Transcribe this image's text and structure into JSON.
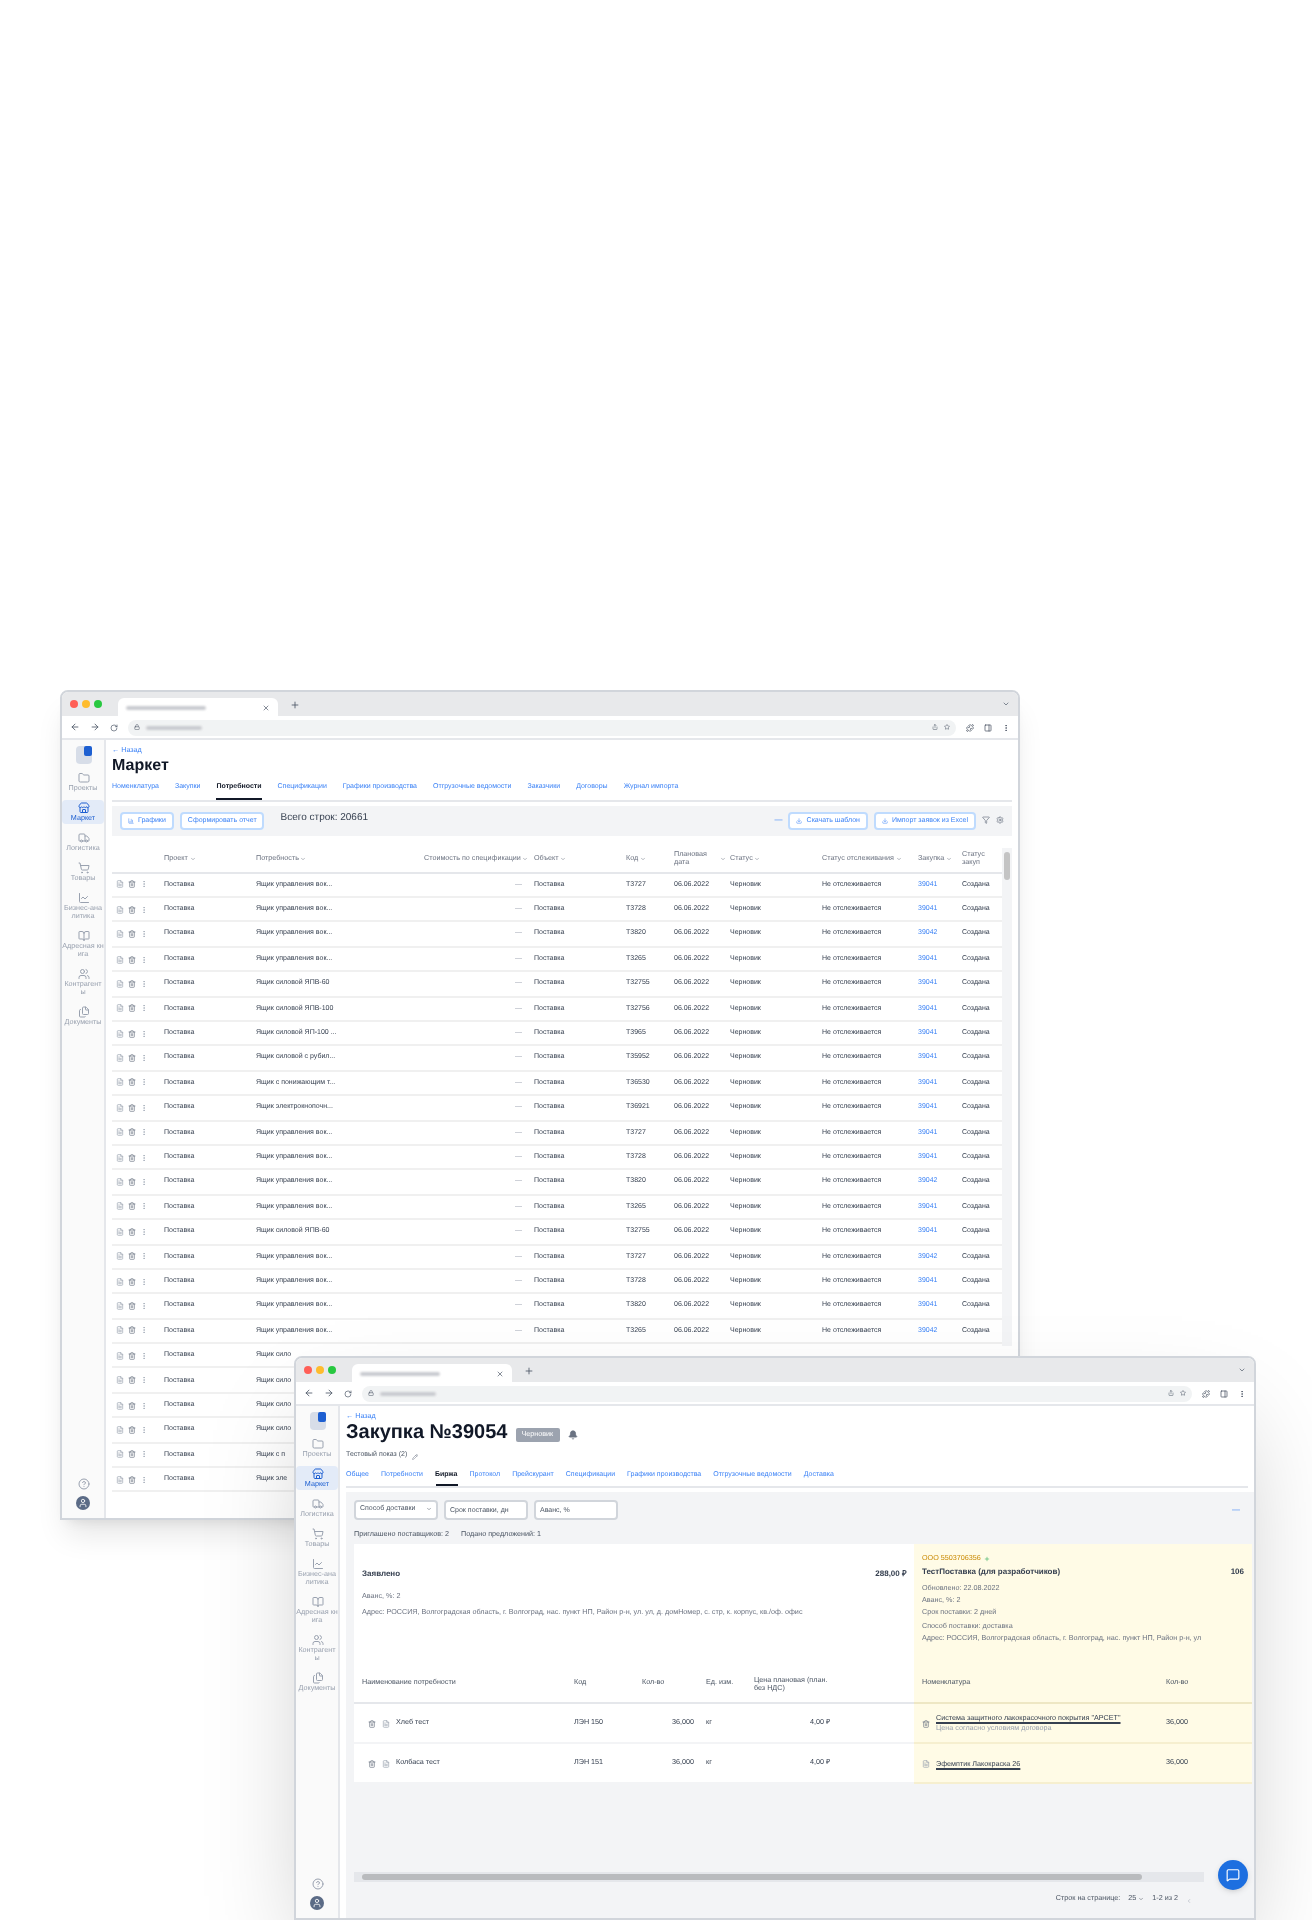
{
  "back_window": {
    "sidebar": {
      "items": [
        {
          "kind": "projects",
          "label": "Проекты",
          "selected": false
        },
        {
          "kind": "market",
          "label": "Маркет",
          "selected": true
        },
        {
          "kind": "logistics",
          "label": "Логистика",
          "selected": false
        },
        {
          "kind": "goods",
          "label": "Товары",
          "selected": false
        },
        {
          "kind": "analytics",
          "label": "Бизнес-аналитика",
          "selected": false
        },
        {
          "kind": "addressbook",
          "label": "Адресная книга",
          "selected": false
        },
        {
          "kind": "contractors",
          "label": "Контрагенты",
          "selected": false
        },
        {
          "kind": "documents",
          "label": "Документы",
          "selected": false
        }
      ]
    },
    "breadcrumb": "← Назад",
    "title": "Маркет",
    "tabs": [
      {
        "label": "Номенклатура",
        "selected": false
      },
      {
        "label": "Закупки",
        "selected": false
      },
      {
        "label": "Потребности",
        "selected": true
      },
      {
        "label": "Спецификации",
        "selected": false
      },
      {
        "label": "Графики производства",
        "selected": false
      },
      {
        "label": "Отгрузочные ведомости",
        "selected": false
      },
      {
        "label": "Заказчики",
        "selected": false
      },
      {
        "label": "Договоры",
        "selected": false
      },
      {
        "label": "Журнал импорта",
        "selected": false
      }
    ],
    "toolbar": {
      "charts_button": "Графики",
      "report_button": "Сформировать отчет",
      "total": "Всего строк: 20661",
      "dash": "—",
      "template_button": "Скачать шаблон",
      "import_button": "Импорт заявок из Excel"
    },
    "table": {
      "columns": [
        "Проект",
        "Потребность",
        "Стоимость по спецификации",
        "Объект",
        "Код",
        "Плановая дата",
        "Статус",
        "Статус отслеживания",
        "Закупка",
        "Статус закуп"
      ],
      "rows": [
        {
          "project": "Поставка",
          "need": "Ящик управления вок...",
          "spec": "—",
          "object": "Поставка",
          "code": "Т3727",
          "date": "06.06.2022",
          "status": "Черновик",
          "tracking": "Не отслеживается",
          "purchase": "39041",
          "purchase_status": "Создана"
        },
        {
          "project": "Поставка",
          "need": "Ящик управления вок...",
          "spec": "—",
          "object": "Поставка",
          "code": "Т3728",
          "date": "06.06.2022",
          "status": "Черновик",
          "tracking": "Не отслеживается",
          "purchase": "39041",
          "purchase_status": "Создана"
        },
        {
          "project": "Поставка",
          "need": "Ящик управления вок...",
          "spec": "—",
          "object": "Поставка",
          "code": "Т3820",
          "date": "06.06.2022",
          "status": "Черновик",
          "tracking": "Не отслеживается",
          "purchase": "39042",
          "purchase_status": "Создана"
        },
        {
          "project": "Поставка",
          "need": "Ящик управления вок...",
          "spec": "—",
          "object": "Поставка",
          "code": "Т3265",
          "date": "06.06.2022",
          "status": "Черновик",
          "tracking": "Не отслеживается",
          "purchase": "39041",
          "purchase_status": "Создана"
        },
        {
          "project": "Поставка",
          "need": "Ящик силовой ЯПВ-60",
          "spec": "—",
          "object": "Поставка",
          "code": "Т32755",
          "date": "06.06.2022",
          "status": "Черновик",
          "tracking": "Не отслеживается",
          "purchase": "39041",
          "purchase_status": "Создана"
        },
        {
          "project": "Поставка",
          "need": "Ящик силовой ЯПВ-100",
          "spec": "—",
          "object": "Поставка",
          "code": "Т32756",
          "date": "06.06.2022",
          "status": "Черновик",
          "tracking": "Не отслеживается",
          "purchase": "39041",
          "purchase_status": "Создана"
        },
        {
          "project": "Поставка",
          "need": "Ящик силовой ЯП-100 ...",
          "spec": "—",
          "object": "Поставка",
          "code": "Т3965",
          "date": "06.06.2022",
          "status": "Черновик",
          "tracking": "Не отслеживается",
          "purchase": "39041",
          "purchase_status": "Создана"
        },
        {
          "project": "Поставка",
          "need": "Ящик силовой с рубил...",
          "spec": "—",
          "object": "Поставка",
          "code": "Т35952",
          "date": "06.06.2022",
          "status": "Черновик",
          "tracking": "Не отслеживается",
          "purchase": "39041",
          "purchase_status": "Создана"
        },
        {
          "project": "Поставка",
          "need": "Ящик с понижающим т...",
          "spec": "—",
          "object": "Поставка",
          "code": "Т36530",
          "date": "06.06.2022",
          "status": "Черновик",
          "tracking": "Не отслеживается",
          "purchase": "39041",
          "purchase_status": "Создана"
        },
        {
          "project": "Поставка",
          "need": "Ящик электрокнопочн...",
          "spec": "—",
          "object": "Поставка",
          "code": "Т36921",
          "date": "06.06.2022",
          "status": "Черновик",
          "tracking": "Не отслеживается",
          "purchase": "39041",
          "purchase_status": "Создана"
        },
        {
          "project": "Поставка",
          "need": "Ящик управления вок...",
          "spec": "—",
          "object": "Поставка",
          "code": "Т3727",
          "date": "06.06.2022",
          "status": "Черновик",
          "tracking": "Не отслеживается",
          "purchase": "39041",
          "purchase_status": "Создана"
        },
        {
          "project": "Поставка",
          "need": "Ящик управления вок...",
          "spec": "—",
          "object": "Поставка",
          "code": "Т3728",
          "date": "06.06.2022",
          "status": "Черновик",
          "tracking": "Не отслеживается",
          "purchase": "39041",
          "purchase_status": "Создана"
        },
        {
          "project": "Поставка",
          "need": "Ящик управления вок...",
          "spec": "—",
          "object": "Поставка",
          "code": "Т3820",
          "date": "06.06.2022",
          "status": "Черновик",
          "tracking": "Не отслеживается",
          "purchase": "39042",
          "purchase_status": "Создана"
        },
        {
          "project": "Поставка",
          "need": "Ящик управления вок...",
          "spec": "—",
          "object": "Поставка",
          "code": "Т3265",
          "date": "06.06.2022",
          "status": "Черновик",
          "tracking": "Не отслеживается",
          "purchase": "39041",
          "purchase_status": "Создана"
        },
        {
          "project": "Поставка",
          "need": "Ящик силовой ЯПВ-60",
          "spec": "—",
          "object": "Поставка",
          "code": "Т32755",
          "date": "06.06.2022",
          "status": "Черновик",
          "tracking": "Не отслеживается",
          "purchase": "39041",
          "purchase_status": "Создана"
        },
        {
          "project": "Поставка",
          "need": "Ящик управления вок...",
          "spec": "—",
          "object": "Поставка",
          "code": "Т3727",
          "date": "06.06.2022",
          "status": "Черновик",
          "tracking": "Не отслеживается",
          "purchase": "39042",
          "purchase_status": "Создана"
        },
        {
          "project": "Поставка",
          "need": "Ящик управления вок...",
          "spec": "—",
          "object": "Поставка",
          "code": "Т3728",
          "date": "06.06.2022",
          "status": "Черновик",
          "tracking": "Не отслеживается",
          "purchase": "39041",
          "purchase_status": "Создана"
        },
        {
          "project": "Поставка",
          "need": "Ящик управления вок...",
          "spec": "—",
          "object": "Поставка",
          "code": "Т3820",
          "date": "06.06.2022",
          "status": "Черновик",
          "tracking": "Не отслеживается",
          "purchase": "39041",
          "purchase_status": "Создана"
        },
        {
          "project": "Поставка",
          "need": "Ящик управления вок...",
          "spec": "—",
          "object": "Поставка",
          "code": "Т3265",
          "date": "06.06.2022",
          "status": "Черновик",
          "tracking": "Не отслеживается",
          "purchase": "39042",
          "purchase_status": "Создана"
        }
      ],
      "covered_rows": [
        {
          "project": "Поставка",
          "need": "Ящик сило"
        },
        {
          "project": "Поставка",
          "need": "Ящик сило"
        },
        {
          "project": "Поставка",
          "need": "Ящик сило"
        },
        {
          "project": "Поставка",
          "need": "Ящик сило"
        },
        {
          "project": "Поставка",
          "need": "Ящик с п"
        },
        {
          "project": "Поставка",
          "need": "Ящик эле"
        }
      ]
    }
  },
  "front_window": {
    "sidebar": {
      "items": [
        {
          "kind": "projects",
          "label": "Проекты",
          "selected": false
        },
        {
          "kind": "market",
          "label": "Маркет",
          "selected": true
        },
        {
          "kind": "logistics",
          "label": "Логистика",
          "selected": false
        },
        {
          "kind": "goods",
          "label": "Товары",
          "selected": false
        },
        {
          "kind": "analytics",
          "label": "Бизнес-аналитика",
          "selected": false
        },
        {
          "kind": "addressbook",
          "label": "Адресная книга",
          "selected": false
        },
        {
          "kind": "contractors",
          "label": "Контрагенты",
          "selected": false
        },
        {
          "kind": "documents",
          "label": "Документы",
          "selected": false
        }
      ]
    },
    "breadcrumb": "← Назад",
    "title": "Закупка №39054",
    "badge": "Черновик",
    "subtitle": "Тестовый показ (2)",
    "tabs": [
      {
        "label": "Общее",
        "selected": false
      },
      {
        "label": "Потребности",
        "selected": false
      },
      {
        "label": "Биржа",
        "selected": true
      },
      {
        "label": "Протокол",
        "selected": false
      },
      {
        "label": "Прейскурант",
        "selected": false
      },
      {
        "label": "Спецификации",
        "selected": false
      },
      {
        "label": "Графики производства",
        "selected": false
      },
      {
        "label": "Отгрузочные ведомости",
        "selected": false
      },
      {
        "label": "Доставка",
        "selected": false
      }
    ],
    "filters": {
      "delivery_select": "Способ доставки",
      "term_placeholder": "Срок поставки, дн",
      "advance_placeholder": "Аванс, %",
      "dash": "—"
    },
    "stats": [
      "Приглашено поставщиков: 2",
      "Подано предложений: 1"
    ],
    "declared": {
      "title": "Заявлено",
      "sum": "288,00 ₽",
      "lines": [
        "Аванс, %: 2",
        "Адрес: РОССИЯ, Волгоградская область, г. Волгоград, нас. пункт НП, Район р-н, ул. ул, д. домНомер, с. стр, к. корпус, кв./оф. офис"
      ]
    },
    "offer": {
      "company": "ООО 5503706356",
      "name": "ТестПоставка (для разработчиков)",
      "sum": "106",
      "lines": [
        "Обновлено: 22.08.2022",
        "Аванс, %: 2",
        "Срок поставки: 2 дней",
        "Способ поставки: доставка",
        "Адрес: РОССИЯ, Волгоградская область, г. Волгоград, нас. пункт НП, Район р-н, ул"
      ]
    },
    "needs_table": {
      "columns": [
        "Наименование потребности",
        "Код",
        "Кол-во",
        "Ед. изм.",
        "Цена плановая (план. без НДС)"
      ],
      "rows": [
        {
          "name": "Хлеб тест",
          "code": "ЛЭН 150",
          "qty": "36,000",
          "unit": "кг",
          "price": "4,00 ₽"
        },
        {
          "name": "Колбаса тест",
          "code": "ЛЭН 151",
          "qty": "36,000",
          "unit": "кг",
          "price": "4,00 ₽"
        }
      ]
    },
    "offer_table": {
      "columns": [
        "Номенклатура",
        "Кол-во"
      ],
      "rows": [
        {
          "name": "Система защитного лакокрасочного покрытия \"АРСЕТ\"",
          "note": "Цена согласно условиям договора",
          "qty": "36,000"
        },
        {
          "name": "Эфемптик Лакокраска 26",
          "qty": "36,000"
        }
      ]
    },
    "pagination": {
      "label": "Строк на странице:",
      "per_page": "25",
      "range": "1-2 из 2"
    }
  }
}
